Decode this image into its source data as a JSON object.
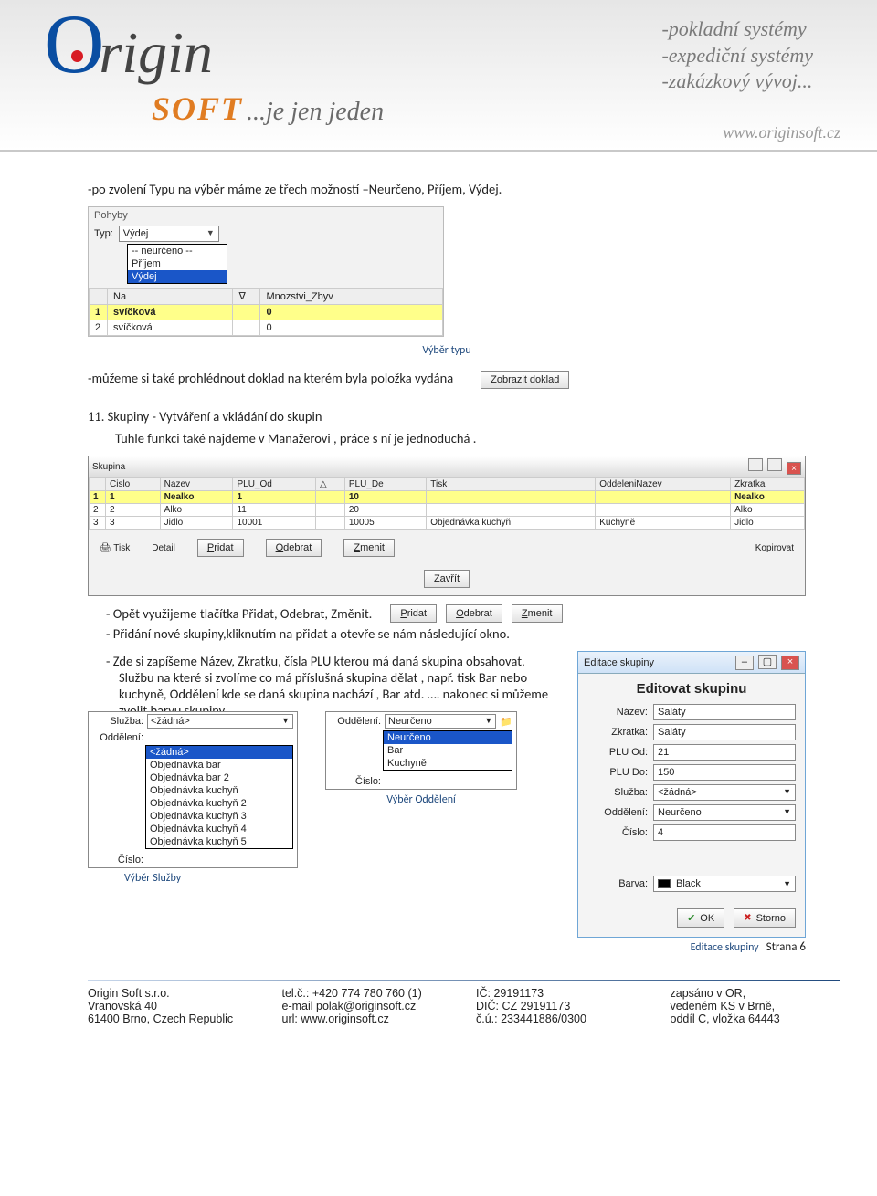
{
  "header": {
    "logo_main": "Origin",
    "logo_soft": "SOFT",
    "logo_slogan": "...je jen jeden",
    "tag1": "-pokladní systémy",
    "tag2": "-expediční systémy",
    "tag3": "-zakázkový vývoj...",
    "url": "www.originsoft.cz"
  },
  "body": {
    "p1": "-po zvolení Typu na výběr máme ze třech možností –Neurčeno, Příjem, Výdej.",
    "cap1": "Výběr typu",
    "p2": "-můžeme si také prohlédnout doklad na kterém byla položka vydána",
    "btn_zobrazit": "Zobrazit doklad",
    "h11": "11. Skupiny - Vytváření a vkládání do skupin",
    "p3": "Tuhle funkci také najdeme v Manažerovi , práce s ní je jednoduchá .",
    "b1": "Opět využijeme tlačítka Přidat, Odebrat, Změnit.",
    "b2": "Přidání nové skupiny,kliknutím na přidat a otevře se nám následující okno.",
    "b3": "Zde si zapíšeme Název, Zkratku, čísla PLU kterou má daná skupina obsahovat, Službu na které si zvolíme co má příslušná skupina dělat , např. tisk Bar nebo kuchyně, Oddělení kde se daná skupina nachází , Bar atd. …. nakonec  si můžeme zvolit barvu skupiny.",
    "cap_odd": "Výběr Oddělení",
    "cap_sluz": "Výběr Služby",
    "cap_edit": "Editace skupiny",
    "btn_pridat": "Pridat",
    "btn_odebrat": "Odebrat",
    "btn_zmenit": "Zmenit"
  },
  "pohyby": {
    "title": "Pohyby",
    "lbl_typ": "Typ:",
    "val_typ": "Výdej",
    "opts": [
      "-- neurčeno --",
      "Příjem",
      "Výdej"
    ],
    "head_na": "Na",
    "head_mn": "Mnozstvi_Zbyv",
    "r1_name": "svíčková",
    "r1_q": "0",
    "r2_name": "svíčková",
    "r2_q": "0"
  },
  "skupina": {
    "title": "Skupina",
    "cols": {
      "cislo": "Cislo",
      "nazev": "Nazev",
      "pluod": "PLU_Od",
      "plude": "PLU_De",
      "tisk": "Tisk",
      "odd": "OddeleniNazev",
      "zkr": "Zkratka"
    },
    "rows": [
      {
        "n": "1",
        "c": "1",
        "naz": "Nealko",
        "od": "1",
        "de": "10",
        "tisk": "",
        "odd": "",
        "zkr": "Nealko",
        "hl": true
      },
      {
        "n": "2",
        "c": "2",
        "naz": "Alko",
        "od": "11",
        "de": "20",
        "tisk": "",
        "odd": "",
        "zkr": "Alko"
      },
      {
        "n": "3",
        "c": "3",
        "naz": "Jidlo",
        "od": "10001",
        "de": "10005",
        "tisk": "Objednávka kuchyň",
        "odd": "Kuchyně",
        "zkr": "Jidlo"
      }
    ],
    "tb": {
      "tisk": "Tisk",
      "detail": "Detail",
      "pridat": "Pridat",
      "odebrat": "Odebrat",
      "zmenit": "Zmenit",
      "kopir": "Kopirovat",
      "zavrit": "Zavřít"
    }
  },
  "edit": {
    "title": "Editace skupiny",
    "heading": "Editovat skupinu",
    "nazev_l": "Název:",
    "nazev": "Saláty",
    "zkr_l": "Zkratka:",
    "zkr": "Saláty",
    "pluod_l": "PLU Od:",
    "pluod": "21",
    "plude_l": "PLU Do:",
    "plude": "150",
    "sluz_l": "Služba:",
    "sluz": "<žádná>",
    "odd_l": "Oddělení:",
    "odd": "Neurčeno",
    "cislo_l": "Číslo:",
    "cislo": "4",
    "barva_l": "Barva:",
    "barva": "Black",
    "ok": "OK",
    "storno": "Storno"
  },
  "sluzba_dd": {
    "lbl_sluz": "Služba:",
    "val": "<žádná>",
    "lbl_odd": "Oddělení:",
    "lbl_cis": "Číslo:",
    "opts": [
      "<žádná>",
      "Objednávka bar",
      "Objednávka bar 2",
      "Objednávka kuchyň",
      "Objednávka kuchyň 2",
      "Objednávka kuchyň 3",
      "Objednávka kuchyň 4",
      "Objednávka kuchyň 5"
    ]
  },
  "odd_dd": {
    "lbl_odd": "Oddělení:",
    "val": "Neurčeno",
    "lbl_cis": "Číslo:",
    "opts": [
      "Neurčeno",
      "Bar",
      "Kuchyně"
    ]
  },
  "footer": {
    "page": "Strana 6",
    "c1a": "Origin Soft s.r.o.",
    "c1b": "Vranovská 40",
    "c1c": "61400 Brno, Czech Republic",
    "c2a": "tel.č.: +420 774 780 760 (1)",
    "c2b": "e-mail polak@originsoft.cz",
    "c2c": "url: www.originsoft.cz",
    "c3a": "IČ: 29191173",
    "c3b": "DIČ: CZ 29191173",
    "c3c": "č.ú.: 233441886/0300",
    "c4a": "zapsáno v OR,",
    "c4b": "vedeném KS v Brně,",
    "c4c": "oddíl C, vložka 64443"
  }
}
